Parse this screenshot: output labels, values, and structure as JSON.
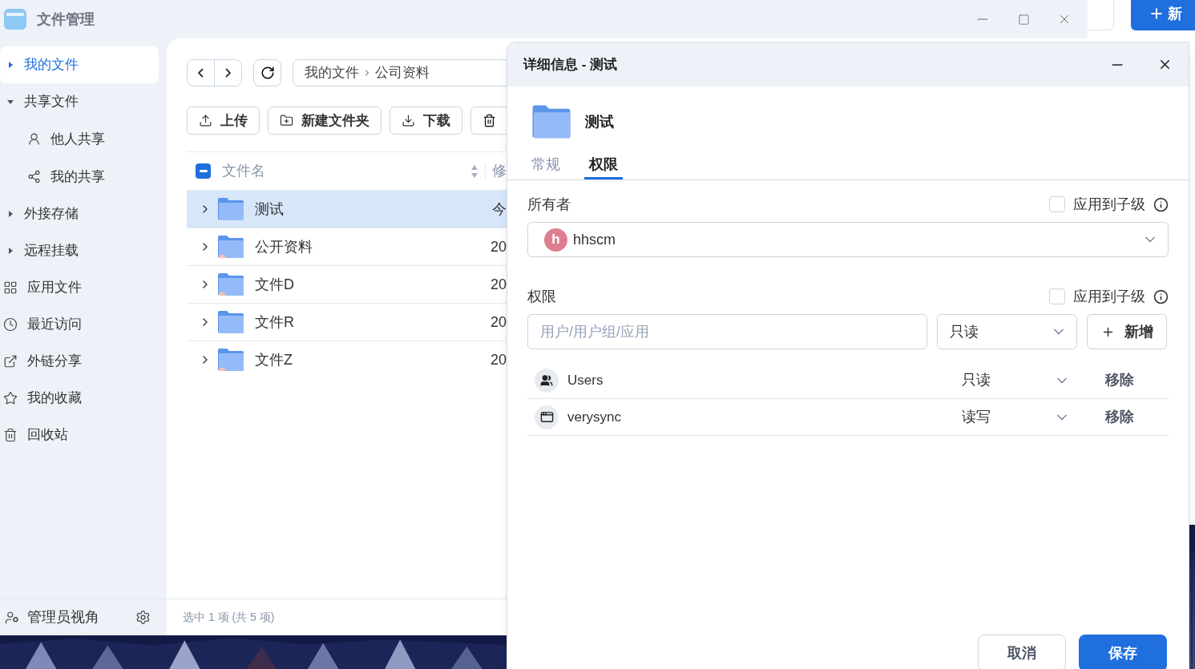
{
  "back_app": {
    "new_button": "新"
  },
  "window": {
    "title": "文件管理"
  },
  "sidebar": {
    "items": [
      {
        "label": "我的文件",
        "selected": true,
        "expanded": false
      },
      {
        "label": "共享文件",
        "selected": false,
        "expanded": true,
        "children": [
          {
            "label": "他人共享",
            "selected": false
          },
          {
            "label": "我的共享",
            "selected": false
          }
        ]
      },
      {
        "label": "外接存储",
        "selected": false,
        "expanded": false
      },
      {
        "label": "远程挂载",
        "selected": false,
        "expanded": false
      },
      {
        "label": "应用文件",
        "selected": false
      },
      {
        "label": "最近访问",
        "selected": false
      },
      {
        "label": "外链分享",
        "selected": false
      },
      {
        "label": "我的收藏",
        "selected": false
      },
      {
        "label": "回收站",
        "selected": false
      }
    ],
    "footer": "管理员视角"
  },
  "breadcrumb": [
    "我的文件",
    "公司资料"
  ],
  "toolbar": [
    "上传",
    "新建文件夹",
    "下载"
  ],
  "table": {
    "select_all": {
      "indeterminate": true
    },
    "columns": [
      "文件名",
      "修"
    ],
    "rows": [
      {
        "name": "测试",
        "column_2": "今",
        "selected": true,
        "shared": false
      },
      {
        "name": "公开资料",
        "column_2": "20",
        "selected": false,
        "shared": true
      },
      {
        "name": "文件D",
        "column_2": "20",
        "selected": false,
        "shared": true
      },
      {
        "name": "文件R",
        "column_2": "20",
        "selected": false,
        "shared": false
      },
      {
        "name": "文件Z",
        "column_2": "20",
        "selected": false,
        "shared": true
      }
    ]
  },
  "status_bar": "选中 1 项 (共 5 项)",
  "dialog": {
    "title": "详细信息 - 测试",
    "name": "测试",
    "tabs": [
      {
        "label": "常规",
        "selected": false
      },
      {
        "label": "权限",
        "selected": true
      }
    ],
    "owner": {
      "label": "所有者",
      "apply_to_children": {
        "label": "应用到子级",
        "checked": false
      },
      "avatar": "h",
      "value": "hhscm"
    },
    "permissions": {
      "label": "权限",
      "apply_to_children": {
        "label": "应用到子级",
        "checked": false
      },
      "placeholder": "用户/用户组/应用",
      "level": "只读",
      "add_button": "新增",
      "entries": [
        {
          "kind": "group",
          "name": "Users",
          "permission": "只读",
          "remove": "移除"
        },
        {
          "kind": "app",
          "name": "verysync",
          "permission": "读写",
          "remove": "移除"
        }
      ]
    },
    "buttons": {
      "cancel": "取消",
      "save": "保存"
    }
  }
}
